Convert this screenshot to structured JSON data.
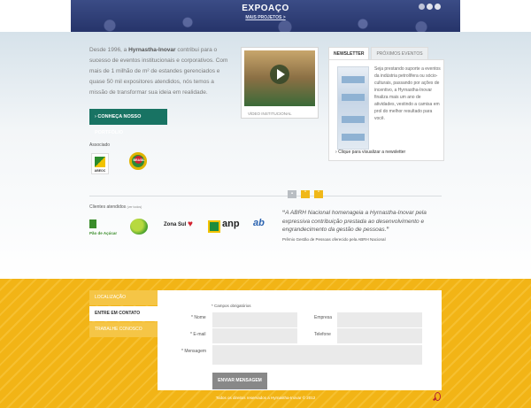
{
  "hero": {
    "title": "EXPOAÇO",
    "subtitle": "MAIS PROJETOS >"
  },
  "intro": {
    "text_1": "Desde 1996, a ",
    "company": "Hyrnastha-Inovar",
    "text_2": " contribui para o sucesso de eventos institucionais e corporativos. Com mais de 1 milhão de m² de estandes gerenciados e quase 50 mil expositores atendidos, nós temos a missão de transformar sua ideia em realidade.",
    "button": "CONHEÇA NOSSO PORTFÓLIO"
  },
  "associados": {
    "title": "Associado",
    "abeoc": "ABEOC",
    "brasil": "BRASIL"
  },
  "video": {
    "caption": "VÍDEO INSTITUCIONAL"
  },
  "newsletter": {
    "tab_active": "NEWSLETTER",
    "tab_other": "PRÓXIMOS EVENTOS",
    "description": "Seja prestando suporte a eventos da indústria petrolífera ou sócio-culturais, passando por ações de incentivo, a Hyrnastha-Inovar finaliza mais um ano de atividades, vestindo a camisa em prol do melhor resultado para você.",
    "link": "Clique para visualizar a newsletter"
  },
  "clients": {
    "title": "Clientes atendidos",
    "subtitle": "(ver todos)",
    "logos": [
      "Pão de Açúcar",
      "",
      "Zona Sul",
      "anp",
      "ab"
    ]
  },
  "quote": {
    "text": "A ABRH Nacional homenageia a Hyrnastha-Inovar pela expressiva contribuição prestada ao desenvolvimento e engrandecimento da gestão de pessoas.",
    "source": "Prêmio Gestão de Pessoas oferecido pela ABRH Nacional"
  },
  "contact_menu": [
    {
      "label": "LOCALIZAÇÃO"
    },
    {
      "label": "ENTRE EM CONTATO"
    },
    {
      "label": "TRABALHE CONOSCO"
    }
  ],
  "form": {
    "required_note": "* Campos obrigatórios",
    "nome": "* Nome",
    "empresa": "Empresa",
    "email": "* E-mail",
    "telefone": "Telefone",
    "mensagem": "* Mensagem",
    "submit": "ENVIAR MENSAGEM"
  },
  "footer": {
    "text": "Todos os direitos reservados a Hyrnastha-Inovar © 2012"
  },
  "colors": {
    "brand_green": "#187363",
    "accent_yellow": "#f2b416",
    "hero_blue": "#2e3d76"
  }
}
